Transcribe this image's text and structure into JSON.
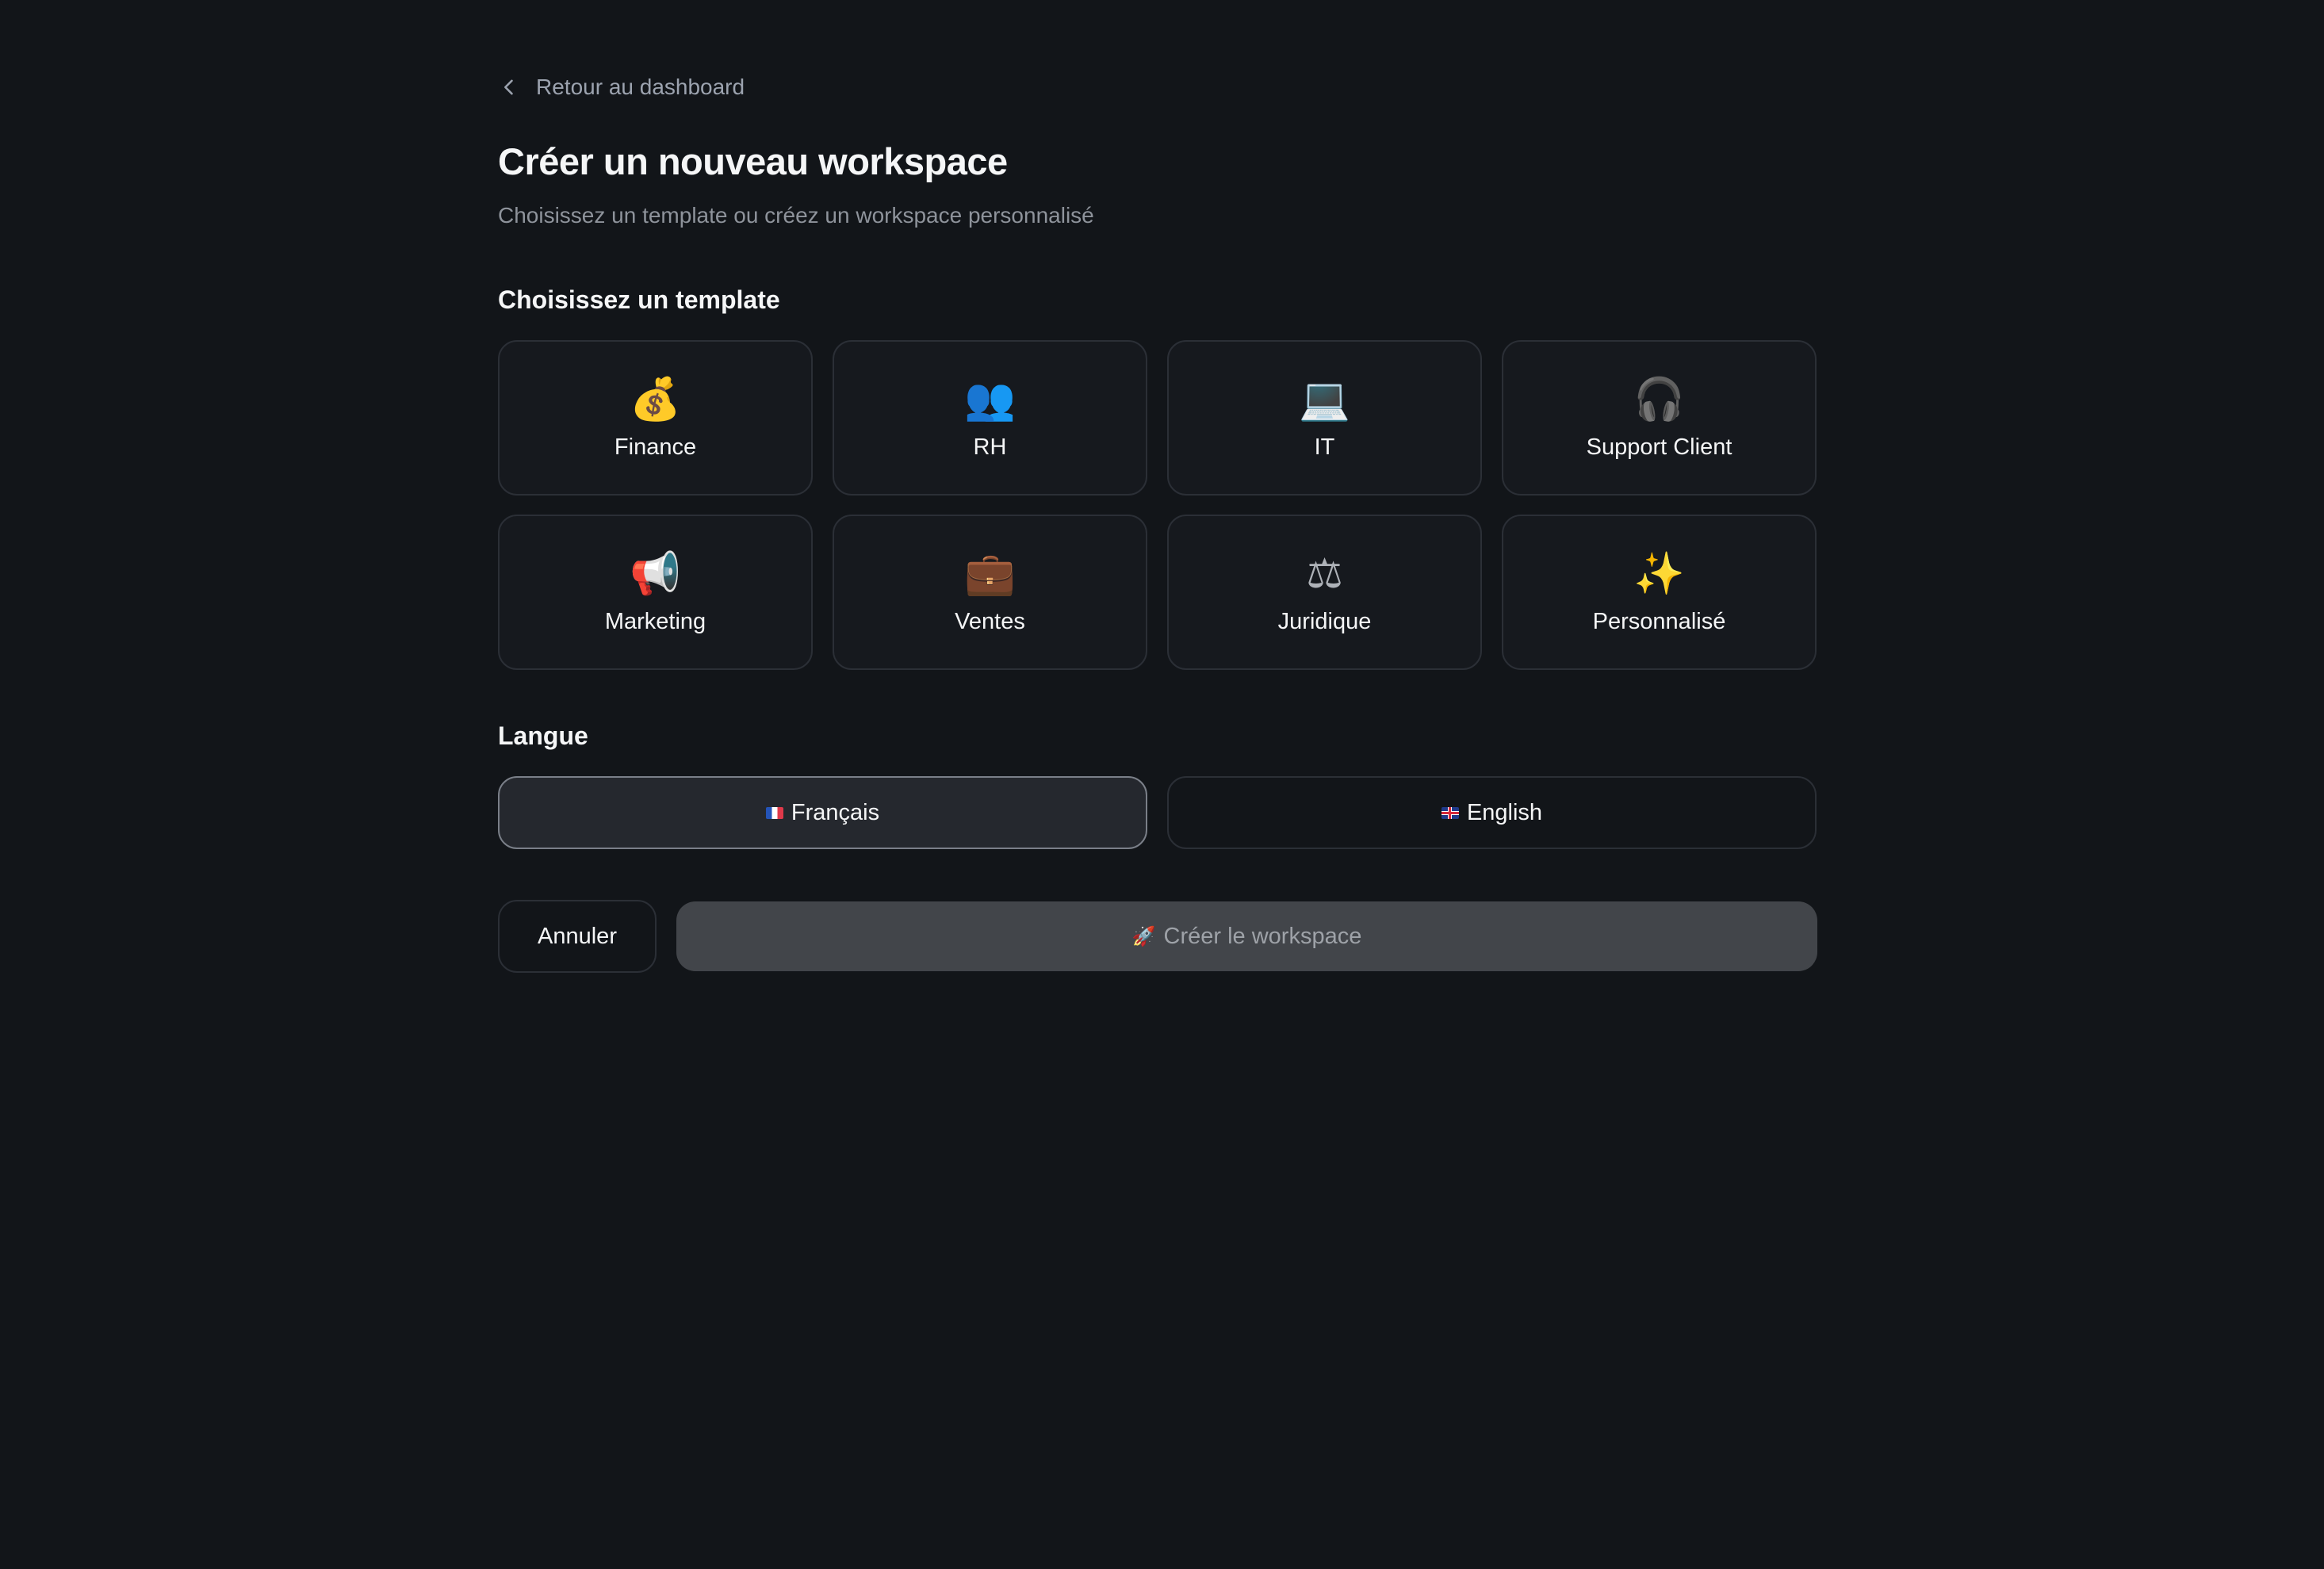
{
  "navigation": {
    "back_label": "Retour au dashboard"
  },
  "header": {
    "title": "Créer un nouveau workspace",
    "subtitle": "Choisissez un template ou créez un workspace personnalisé"
  },
  "templates": {
    "section_title": "Choisissez un template",
    "items": [
      {
        "label": "Finance",
        "icon": "money-bag-icon",
        "glyph": "💰"
      },
      {
        "label": "RH",
        "icon": "people-icon",
        "glyph": "👥"
      },
      {
        "label": "IT",
        "icon": "laptop-icon",
        "glyph": "💻"
      },
      {
        "label": "Support Client",
        "icon": "headphones-icon",
        "glyph": "🎧"
      },
      {
        "label": "Marketing",
        "icon": "megaphone-icon",
        "glyph": "📢"
      },
      {
        "label": "Ventes",
        "icon": "briefcase-icon",
        "glyph": "💼"
      },
      {
        "label": "Juridique",
        "icon": "scales-icon",
        "glyph": "⚖"
      },
      {
        "label": "Personnalisé",
        "icon": "sparkles-icon",
        "glyph": "✨"
      }
    ]
  },
  "language": {
    "section_title": "Langue",
    "options": [
      {
        "label": "Français",
        "flag": "flag-fr-icon",
        "selected": true
      },
      {
        "label": "English",
        "flag": "flag-uk-icon",
        "selected": false
      }
    ]
  },
  "actions": {
    "cancel_label": "Annuler",
    "create_label": "Créer le workspace",
    "create_icon": "rocket-icon",
    "create_disabled": true
  }
}
